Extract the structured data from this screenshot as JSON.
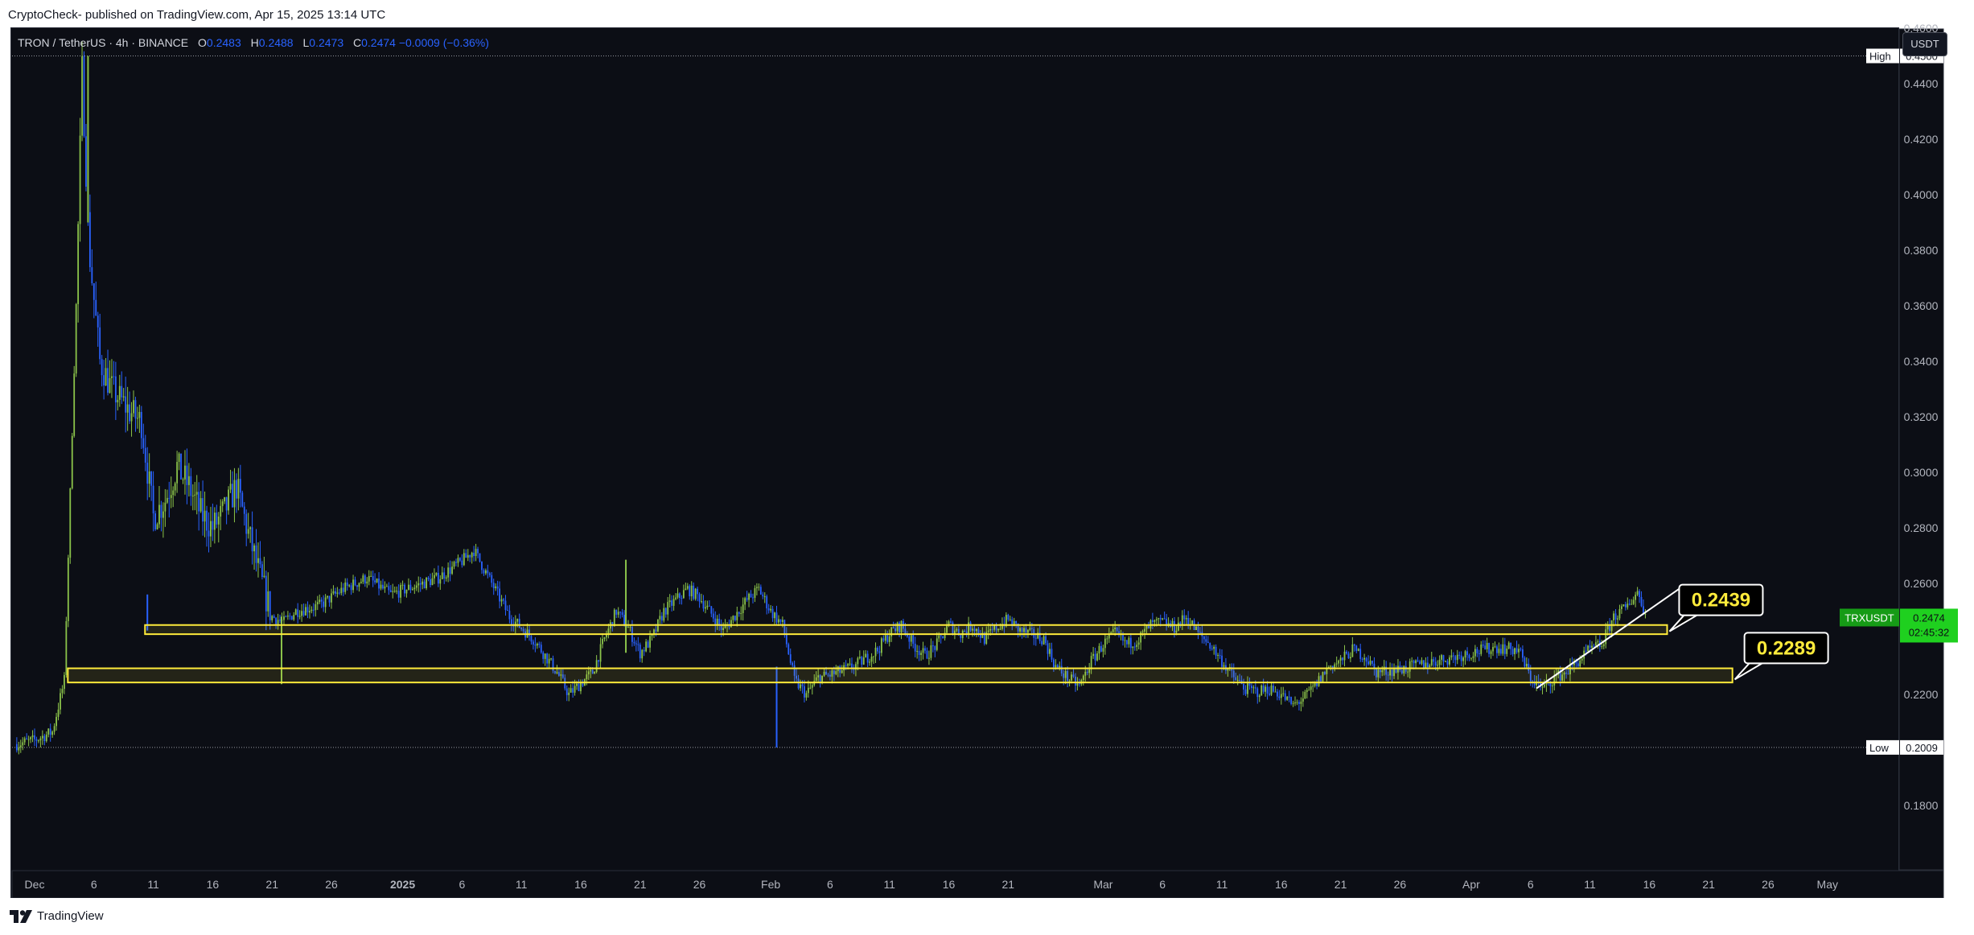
{
  "header": {
    "publisher_line": "CryptoCheck- published on TradingView.com, Apr 15, 2025 13:14 UTC"
  },
  "symbol": {
    "title": "TRON / TetherUS · 4h · BINANCE",
    "o_label": "O",
    "o_value": "0.2483",
    "h_label": "H",
    "h_value": "0.2488",
    "l_label": "L",
    "l_value": "0.2473",
    "c_label": "C",
    "c_value": "0.2474 −0.0009 (−0.36%)"
  },
  "currency_badge": "USDT",
  "footer": {
    "brand": "TradingView"
  },
  "colors": {
    "background": "#0c0e15",
    "up": "#8bc34a",
    "down": "#2962ff",
    "zone": "#ffeb3b",
    "last_price": "#1fd01f"
  },
  "chart_data": {
    "type": "candlestick",
    "ylim": [
      0.175,
      0.4745
    ],
    "price_ticks": [
      "0.4600",
      "0.4400",
      "0.4200",
      "0.4000",
      "0.3800",
      "0.3600",
      "0.3400",
      "0.3200",
      "0.3000",
      "0.2800",
      "0.2600",
      "0.2200",
      "0.1800"
    ],
    "x_ticks": [
      {
        "label": "Dec",
        "day": 0
      },
      {
        "label": "6",
        "day": 5
      },
      {
        "label": "11",
        "day": 10
      },
      {
        "label": "16",
        "day": 15
      },
      {
        "label": "21",
        "day": 20
      },
      {
        "label": "26",
        "day": 25
      },
      {
        "label": "2025",
        "day": 31
      },
      {
        "label": "6",
        "day": 36
      },
      {
        "label": "11",
        "day": 41
      },
      {
        "label": "16",
        "day": 46
      },
      {
        "label": "21",
        "day": 51
      },
      {
        "label": "26",
        "day": 56
      },
      {
        "label": "Feb",
        "day": 62
      },
      {
        "label": "6",
        "day": 67
      },
      {
        "label": "11",
        "day": 72
      },
      {
        "label": "16",
        "day": 77
      },
      {
        "label": "21",
        "day": 82
      },
      {
        "label": "Mar",
        "day": 90
      },
      {
        "label": "6",
        "day": 95
      },
      {
        "label": "11",
        "day": 100
      },
      {
        "label": "16",
        "day": 105
      },
      {
        "label": "21",
        "day": 110
      },
      {
        "label": "26",
        "day": 115
      },
      {
        "label": "Apr",
        "day": 121
      },
      {
        "label": "6",
        "day": 126
      },
      {
        "label": "11",
        "day": 131
      },
      {
        "label": "16",
        "day": 136
      },
      {
        "label": "21",
        "day": 141
      },
      {
        "label": "26",
        "day": 146
      },
      {
        "label": "May",
        "day": 151
      }
    ],
    "price_path": [
      [
        -1.5,
        0.2021
      ],
      [
        0,
        0.2035
      ],
      [
        1.5,
        0.2065
      ],
      [
        2.5,
        0.225
      ],
      [
        3.5,
        0.36
      ],
      [
        4,
        0.445
      ],
      [
        4.6,
        0.38
      ],
      [
        5.5,
        0.34
      ],
      [
        6.5,
        0.33
      ],
      [
        8,
        0.322
      ],
      [
        9,
        0.318
      ],
      [
        10,
        0.284
      ],
      [
        11,
        0.29
      ],
      [
        12,
        0.302
      ],
      [
        13,
        0.295
      ],
      [
        14,
        0.285
      ],
      [
        15,
        0.28
      ],
      [
        16,
        0.286
      ],
      [
        17,
        0.295
      ],
      [
        18,
        0.278
      ],
      [
        19,
        0.262
      ],
      [
        20,
        0.248
      ],
      [
        21,
        0.246
      ],
      [
        22,
        0.25
      ],
      [
        24,
        0.252
      ],
      [
        26,
        0.258
      ],
      [
        28,
        0.262
      ],
      [
        30,
        0.256
      ],
      [
        32,
        0.259
      ],
      [
        34,
        0.262
      ],
      [
        36,
        0.268
      ],
      [
        37,
        0.272
      ],
      [
        38,
        0.264
      ],
      [
        40,
        0.248
      ],
      [
        42,
        0.24
      ],
      [
        44,
        0.228
      ],
      [
        45,
        0.22
      ],
      [
        47,
        0.228
      ],
      [
        48,
        0.24
      ],
      [
        49,
        0.25
      ],
      [
        50,
        0.244
      ],
      [
        51,
        0.235
      ],
      [
        52,
        0.24
      ],
      [
        53,
        0.25
      ],
      [
        55,
        0.258
      ],
      [
        56,
        0.255
      ],
      [
        58,
        0.243
      ],
      [
        60,
        0.254
      ],
      [
        61,
        0.258
      ],
      [
        62,
        0.25
      ],
      [
        63,
        0.245
      ],
      [
        64,
        0.225
      ],
      [
        65,
        0.22
      ],
      [
        66,
        0.226
      ],
      [
        67,
        0.227
      ],
      [
        69,
        0.23
      ],
      [
        71,
        0.236
      ],
      [
        72,
        0.242
      ],
      [
        73,
        0.245
      ],
      [
        74,
        0.238
      ],
      [
        75,
        0.234
      ],
      [
        76,
        0.238
      ],
      [
        77,
        0.245
      ],
      [
        78,
        0.242
      ],
      [
        79,
        0.245
      ],
      [
        80,
        0.24
      ],
      [
        81,
        0.244
      ],
      [
        82,
        0.247
      ],
      [
        83,
        0.243
      ],
      [
        85,
        0.24
      ],
      [
        86,
        0.23
      ],
      [
        87,
        0.226
      ],
      [
        88,
        0.223
      ],
      [
        89,
        0.232
      ],
      [
        90,
        0.238
      ],
      [
        91,
        0.242
      ],
      [
        92,
        0.238
      ],
      [
        93,
        0.24
      ],
      [
        94,
        0.245
      ],
      [
        95,
        0.246
      ],
      [
        96,
        0.244
      ],
      [
        97,
        0.248
      ],
      [
        98,
        0.242
      ],
      [
        99,
        0.238
      ],
      [
        100,
        0.232
      ],
      [
        101,
        0.226
      ],
      [
        102,
        0.222
      ],
      [
        103,
        0.221
      ],
      [
        104,
        0.222
      ],
      [
        105,
        0.22
      ],
      [
        106,
        0.216
      ],
      [
        107,
        0.219
      ],
      [
        108,
        0.224
      ],
      [
        109,
        0.23
      ],
      [
        110,
        0.232
      ],
      [
        111,
        0.236
      ],
      [
        112,
        0.234
      ],
      [
        113,
        0.228
      ],
      [
        115,
        0.229
      ],
      [
        117,
        0.231
      ],
      [
        119,
        0.233
      ],
      [
        121,
        0.235
      ],
      [
        123,
        0.237
      ],
      [
        125,
        0.236
      ],
      [
        126,
        0.226
      ],
      [
        127,
        0.222
      ],
      [
        128,
        0.226
      ],
      [
        129,
        0.228
      ],
      [
        130,
        0.232
      ],
      [
        131,
        0.236
      ],
      [
        132,
        0.238
      ],
      [
        133,
        0.248
      ],
      [
        134,
        0.251
      ],
      [
        135,
        0.257
      ],
      [
        135.8,
        0.2474
      ]
    ],
    "wicks": [
      {
        "day": 20.8,
        "low": 0.2237,
        "high": 0.248,
        "up": true
      },
      {
        "day": 49.8,
        "low": 0.235,
        "high": 0.2685,
        "up": true
      },
      {
        "day": 62.5,
        "low": 0.2009,
        "high": 0.23,
        "up": false
      },
      {
        "day": 9.5,
        "low": 0.243,
        "high": 0.256,
        "up": false
      },
      {
        "day": 4.5,
        "low": 0.39,
        "high": 0.45,
        "up": true
      }
    ],
    "zones": [
      {
        "name": "upper-zone",
        "y_low": 0.2417,
        "y_high": 0.245,
        "day_start": 9.3,
        "day_end": 137.5
      },
      {
        "name": "lower-zone",
        "y_low": 0.2243,
        "y_high": 0.2294,
        "day_start": 2.8,
        "day_end": 143.0
      }
    ],
    "trendline": {
      "day_start": 126.5,
      "price_start": 0.2222,
      "day_end": 138.5,
      "price_end": 0.258
    },
    "callouts": [
      {
        "label": "0.2439",
        "price": 0.2427,
        "day": 137.7
      },
      {
        "label": "0.2289",
        "price": 0.2254,
        "day": 143.2
      }
    ],
    "high_marker": {
      "tag": "High",
      "value": "0.4500",
      "price": 0.45
    },
    "low_marker": {
      "tag": "Low",
      "value": "0.2009",
      "price": 0.2009
    },
    "last_price": {
      "symbol": "TRXUSDT",
      "value": "0.2474",
      "countdown": "02:45:32",
      "price": 0.2474
    },
    "grid": false
  }
}
